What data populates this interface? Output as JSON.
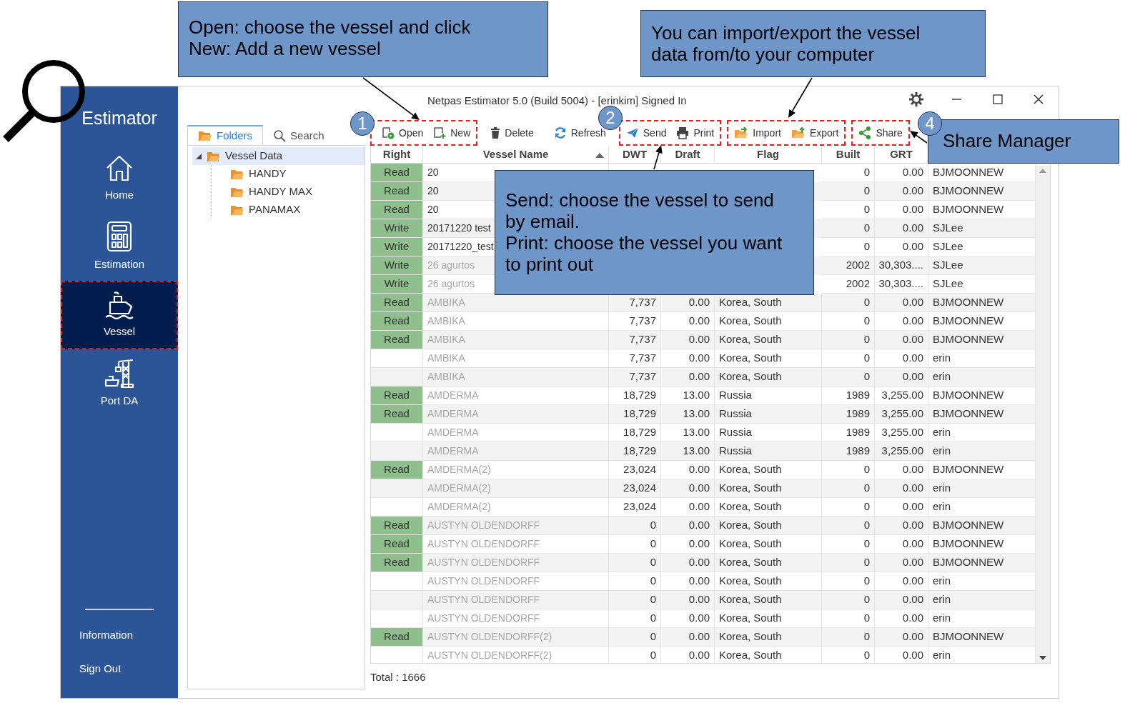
{
  "window": {
    "title": "Netpas Estimator 5.0 (Build 5004) - [erinkim] Signed In"
  },
  "sidebar": {
    "app_name": "Estimator",
    "items": [
      {
        "label": "Home",
        "selected": false,
        "highlighted": false
      },
      {
        "label": "Estimation",
        "selected": false,
        "highlighted": false
      },
      {
        "label": "Vessel",
        "selected": true,
        "highlighted": true
      },
      {
        "label": "Port DA",
        "selected": false,
        "highlighted": false
      }
    ],
    "footer_links": [
      "Information",
      "Sign Out"
    ]
  },
  "folder_panel": {
    "tabs": [
      {
        "label": "Folders",
        "selected": true
      },
      {
        "label": "Search",
        "selected": false
      }
    ],
    "tree": [
      {
        "label": "Vessel Data",
        "selected": true,
        "expanded": true,
        "children": [
          {
            "label": "HANDY",
            "selected": false
          },
          {
            "label": "HANDY MAX",
            "selected": false
          },
          {
            "label": "PANAMAX",
            "selected": false
          }
        ]
      }
    ]
  },
  "toolbar": {
    "groups": [
      {
        "highlighted": true,
        "buttons": [
          {
            "label": "Open"
          },
          {
            "label": "New"
          }
        ]
      },
      {
        "highlighted": false,
        "buttons": [
          {
            "label": "Delete"
          }
        ]
      },
      {
        "highlighted": false,
        "buttons": [
          {
            "label": "Refresh"
          }
        ]
      },
      {
        "highlighted": true,
        "buttons": [
          {
            "label": "Send"
          },
          {
            "label": "Print"
          }
        ]
      },
      {
        "highlighted": true,
        "buttons": [
          {
            "label": "Import"
          },
          {
            "label": "Export"
          }
        ]
      },
      {
        "highlighted": true,
        "buttons": [
          {
            "label": "Share"
          }
        ]
      }
    ]
  },
  "table": {
    "columns": [
      {
        "label": "Right",
        "sorted": false
      },
      {
        "label": "Vessel Name",
        "sorted": true
      },
      {
        "label": "DWT",
        "sorted": false
      },
      {
        "label": "Draft",
        "sorted": false
      },
      {
        "label": "Flag",
        "sorted": false
      },
      {
        "label": "Built",
        "sorted": false
      },
      {
        "label": "GRT",
        "sorted": false
      }
    ],
    "rows": [
      {
        "right": "Read",
        "vessel_name": "20",
        "built": "0",
        "grt": "0.00",
        "column_8": "BJMOONNEW"
      },
      {
        "right": "Read",
        "vessel_name": "20",
        "built": "0",
        "grt": "0.00",
        "column_8": "BJMOONNEW"
      },
      {
        "right": "Read",
        "vessel_name": "20",
        "built": "0",
        "grt": "0.00",
        "column_8": "BJMOONNEW"
      },
      {
        "right": "Write",
        "vessel_name": "20171220 test",
        "built": "0",
        "grt": "0.00",
        "column_8": "SJLee"
      },
      {
        "right": "Write",
        "vessel_name": "20171220_test",
        "built": "0",
        "grt": "0.00",
        "column_8": "SJLee"
      },
      {
        "right": "Write",
        "vessel_name": "26 agurtos",
        "obscured": true,
        "built": "2002",
        "grt": "30,303....",
        "column_8": "SJLee"
      },
      {
        "right": "Write",
        "vessel_name": "26 agurtos",
        "obscured": true,
        "built": "2002",
        "grt": "30,303....",
        "column_8": "SJLee"
      },
      {
        "right": "Read",
        "vessel_name": "AMBIKA",
        "obscured": true,
        "dwt": "7,737",
        "draft": "0.00",
        "flag": "Korea, South",
        "built": "0",
        "grt": "0.00",
        "column_8": "BJMOONNEW"
      },
      {
        "right": "Read",
        "vessel_name": "AMBIKA",
        "obscured": true,
        "dwt": "7,737",
        "draft": "0.00",
        "flag": "Korea, South",
        "built": "0",
        "grt": "0.00",
        "column_8": "BJMOONNEW"
      },
      {
        "right": "Read",
        "vessel_name": "AMBIKA",
        "obscured": true,
        "dwt": "7,737",
        "draft": "0.00",
        "flag": "Korea, South",
        "built": "0",
        "grt": "0.00",
        "column_8": "BJMOONNEW"
      },
      {
        "vessel_name": "AMBIKA",
        "obscured": true,
        "dwt": "7,737",
        "draft": "0.00",
        "flag": "Korea, South",
        "built": "0",
        "grt": "0.00",
        "column_8": "erin"
      },
      {
        "vessel_name": "AMBIKA",
        "obscured": true,
        "dwt": "7,737",
        "draft": "0.00",
        "flag": "Korea, South",
        "built": "0",
        "grt": "0.00",
        "column_8": "erin"
      },
      {
        "right": "Read",
        "vessel_name": "AMDERMA",
        "obscured": true,
        "dwt": "18,729",
        "draft": "13.00",
        "flag": "Russia",
        "built": "1989",
        "grt": "3,255.00",
        "column_8": "BJMOONNEW"
      },
      {
        "right": "Read",
        "vessel_name": "AMDERMA",
        "obscured": true,
        "dwt": "18,729",
        "draft": "13.00",
        "flag": "Russia",
        "built": "1989",
        "grt": "3,255.00",
        "column_8": "BJMOONNEW"
      },
      {
        "vessel_name": "AMDERMA",
        "obscured": true,
        "dwt": "18,729",
        "draft": "13.00",
        "flag": "Russia",
        "built": "1989",
        "grt": "3,255.00",
        "column_8": "erin"
      },
      {
        "vessel_name": "AMDERMA",
        "obscured": true,
        "dwt": "18,729",
        "draft": "13.00",
        "flag": "Russia",
        "built": "1989",
        "grt": "3,255.00",
        "column_8": "erin"
      },
      {
        "right": "Read",
        "vessel_name": "AMDERMA(2)",
        "obscured": true,
        "dwt": "23,024",
        "draft": "0.00",
        "flag": "Korea, South",
        "built": "0",
        "grt": "0.00",
        "column_8": "BJMOONNEW"
      },
      {
        "vessel_name": "AMDERMA(2)",
        "obscured": true,
        "dwt": "23,024",
        "draft": "0.00",
        "flag": "Korea, South",
        "built": "0",
        "grt": "0.00",
        "column_8": "erin"
      },
      {
        "vessel_name": "AMDERMA(2)",
        "obscured": true,
        "dwt": "23,024",
        "draft": "0.00",
        "flag": "Korea, South",
        "built": "0",
        "grt": "0.00",
        "column_8": "erin"
      },
      {
        "right": "Read",
        "vessel_name": "AUSTYN OLDENDORFF",
        "obscured": true,
        "dwt": "0",
        "draft": "0.00",
        "flag": "Korea, South",
        "built": "0",
        "grt": "0.00",
        "column_8": "BJMOONNEW"
      },
      {
        "right": "Read",
        "vessel_name": "AUSTYN OLDENDORFF",
        "obscured": true,
        "dwt": "0",
        "draft": "0.00",
        "flag": "Korea, South",
        "built": "0",
        "grt": "0.00",
        "column_8": "BJMOONNEW"
      },
      {
        "right": "Read",
        "vessel_name": "AUSTYN OLDENDORFF",
        "obscured": true,
        "dwt": "0",
        "draft": "0.00",
        "flag": "Korea, South",
        "built": "0",
        "grt": "0.00",
        "column_8": "BJMOONNEW"
      },
      {
        "vessel_name": "AUSTYN OLDENDORFF",
        "obscured": true,
        "dwt": "0",
        "draft": "0.00",
        "flag": "Korea, South",
        "built": "0",
        "grt": "0.00",
        "column_8": "erin"
      },
      {
        "vessel_name": "AUSTYN OLDENDORFF",
        "obscured": true,
        "dwt": "0",
        "draft": "0.00",
        "flag": "Korea, South",
        "built": "0",
        "grt": "0.00",
        "column_8": "erin"
      },
      {
        "vessel_name": "AUSTYN OLDENDORFF",
        "obscured": true,
        "dwt": "0",
        "draft": "0.00",
        "flag": "Korea, South",
        "built": "0",
        "grt": "0.00",
        "column_8": "erin"
      },
      {
        "right": "Read",
        "vessel_name": "AUSTYN OLDENDORFF(2)",
        "obscured": true,
        "dwt": "0",
        "draft": "0.00",
        "flag": "Korea, South",
        "built": "0",
        "grt": "0.00",
        "column_8": "BJMOONNEW"
      },
      {
        "vessel_name": "AUSTYN OLDENDORFF(2)",
        "obscured": true,
        "dwt": "0",
        "draft": "0.00",
        "flag": "Korea, South",
        "built": "0",
        "grt": "0.00",
        "column_8": "erin"
      }
    ]
  },
  "status_bar": "Total : 1666",
  "callouts": [
    {
      "paragraphs": [
        "Open: choose the vessel and click",
        "New: Add a new vessel"
      ]
    },
    {
      "paragraphs": [
        "You can import/export the vessel data from/to your computer"
      ]
    },
    {
      "paragraphs": [
        "Share Manager"
      ]
    },
    {
      "paragraphs": [
        "Send: choose the vessel to send by email.",
        "Print: choose the vessel you want to print out"
      ]
    }
  ],
  "step_markers": [
    "1",
    "2",
    "4"
  ]
}
